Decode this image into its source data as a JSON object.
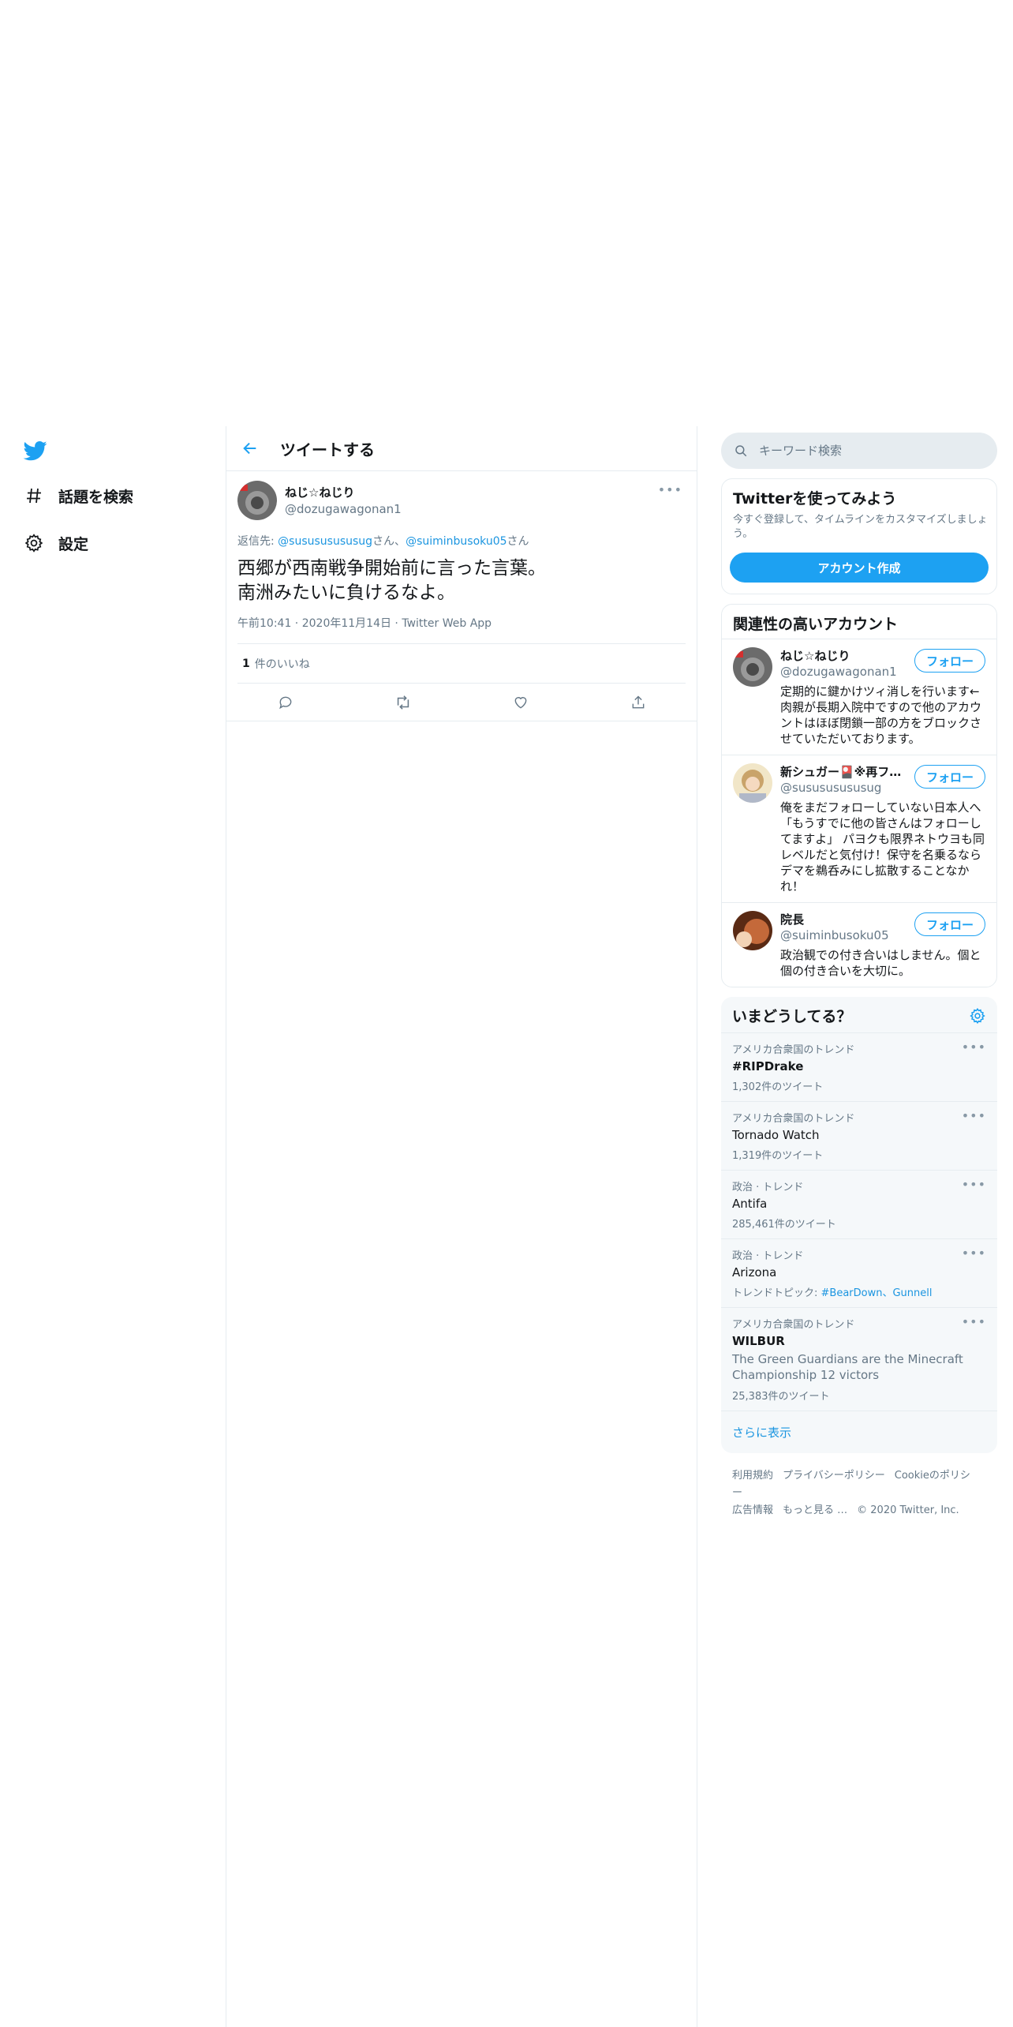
{
  "nav": {
    "logo_icon": "twitter-bird-icon",
    "items": [
      {
        "label": "話題を検索",
        "icon": "hashtag-icon"
      },
      {
        "label": "設定",
        "icon": "gear-icon"
      }
    ]
  },
  "main": {
    "title": "ツイートする",
    "tweet": {
      "name": "ねじ☆ねじり",
      "handle": "@dozugawagonan1",
      "reply_prefix": "返信先: ",
      "reply_user1": "@susususususug",
      "reply_mid": "さん、",
      "reply_user2": "@suiminbusoku05",
      "reply_suffix": "さん",
      "text": "西郷が西南戦争開始前に言った言葉。\n南洲みたいに負けるなよ。",
      "time": "午前10:41",
      "date": "2020年11月14日",
      "source": "Twitter Web App",
      "likes_count": "1",
      "likes_label": "件のいいね"
    }
  },
  "right": {
    "search_placeholder": "キーワード検索",
    "signup": {
      "title": "Twitterを使ってみよう",
      "subtitle": "今すぐ登録して、タイムラインをカスタマイズしましょう。",
      "button": "アカウント作成"
    },
    "related": {
      "title": "関連性の高いアカウント",
      "follow_label": "フォロー",
      "accounts": [
        {
          "name": "ねじ☆ねじり",
          "handle": "@dozugawagonan1",
          "bio": "定期的に鍵かけツィ消しを行います←肉親が長期入院中ですので他のアカウントはほぼ閉鎖一部の方をブロックさせていただいております。"
        },
        {
          "name": "新シュガー🎴※再フォ…",
          "handle": "@susususususug",
          "bio": "俺をまだフォローしていない日本人へ「もうすでに他の皆さんはフォローしてますよ」 パヨクも限界ネトウヨも同レベルだと気付け！保守を名乗るならデマを鵜呑みにし拡散することなかれ！"
        },
        {
          "name": "院長",
          "handle": "@suiminbusoku05",
          "bio": "政治観での付き合いはしません。個と個の付き合いを大切に。"
        }
      ]
    },
    "trends": {
      "title": "いまどうしてる？",
      "items": [
        {
          "context": "アメリカ合衆国のトレンド",
          "name": "#RIPDrake",
          "count": "1,302件のツイート"
        },
        {
          "context": "アメリカ合衆国のトレンド",
          "name": "Tornado Watch",
          "count": "1,319件のツイート"
        },
        {
          "context": "政治 · トレンド",
          "name": "Antifa",
          "count": "285,461件のツイート"
        },
        {
          "context": "政治 · トレンド",
          "name": "Arizona",
          "topic_prefix": "トレンドトピック: ",
          "topic_links": "#BearDown、Gunnell"
        },
        {
          "context": "アメリカ合衆国のトレンド",
          "name": "WILBUR",
          "description": "The Green Guardians are the Minecraft Championship 12 victors",
          "count": "25,383件のツイート"
        }
      ],
      "show_more": "さらに表示"
    },
    "footer": {
      "links": [
        "利用規約",
        "プライバシーポリシー",
        "Cookieのポリシー",
        "広告情報",
        "もっと見る …"
      ],
      "copyright": "© 2020 Twitter, Inc."
    }
  },
  "colors": {
    "accent": "#1da1f2",
    "secondary": "#657786",
    "border": "#e6ecf0"
  }
}
